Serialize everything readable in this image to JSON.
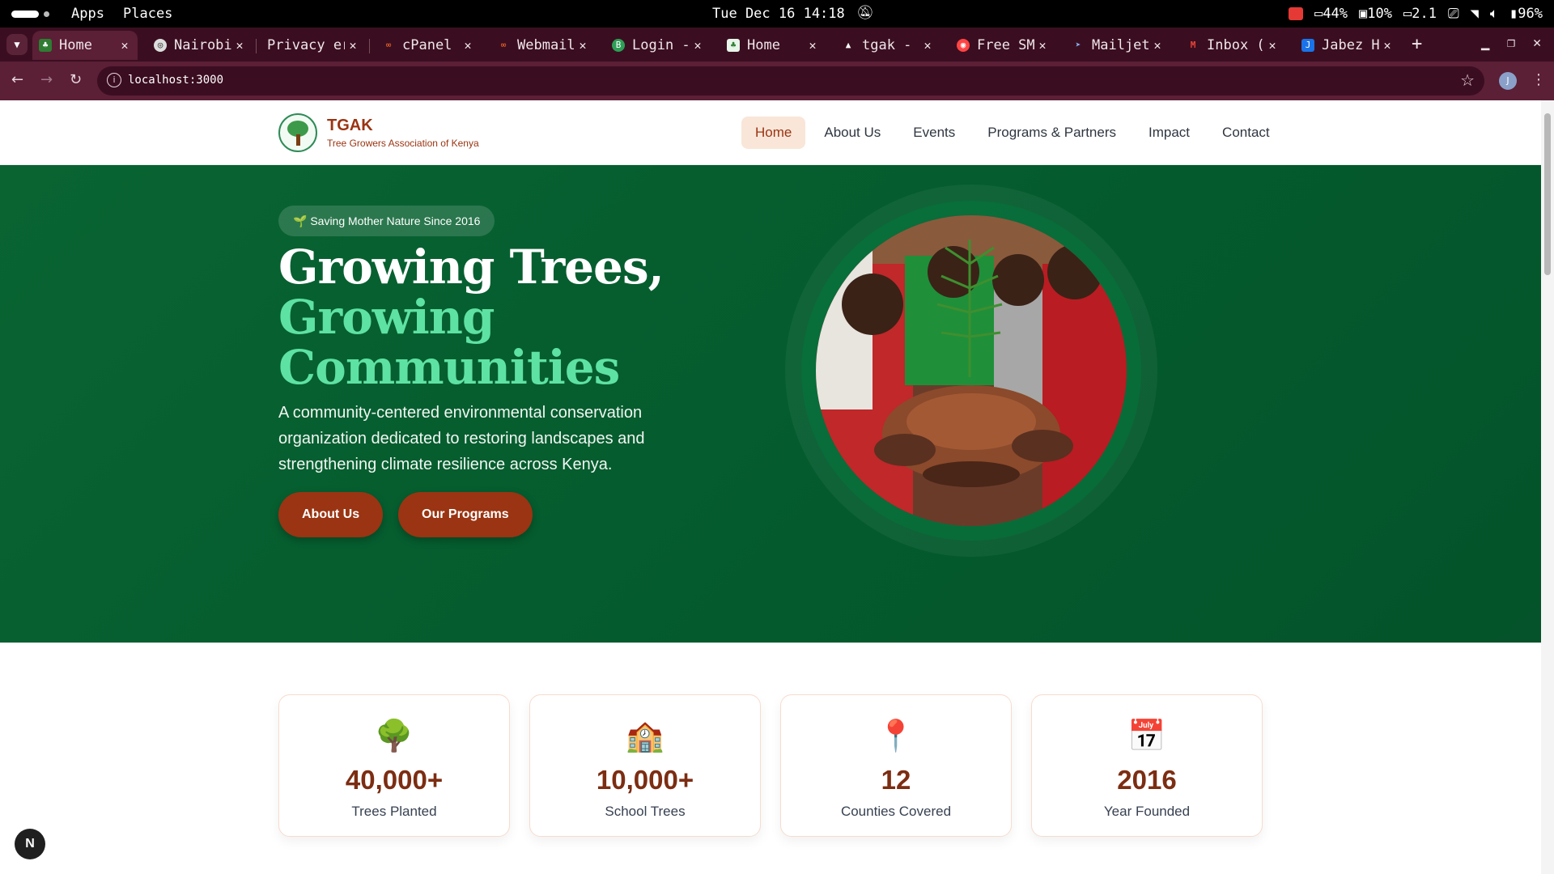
{
  "os": {
    "menu_apps": "Apps",
    "menu_places": "Places",
    "clock": "Tue Dec 16 14:18",
    "tray": {
      "cpu": "44%",
      "mem": "10%",
      "load": "2.1",
      "battery": "96%"
    }
  },
  "browser": {
    "tabs": [
      {
        "title": "Home",
        "active": true
      },
      {
        "title": "Nairobi"
      },
      {
        "title": "Privacy er"
      },
      {
        "title": "cPanel"
      },
      {
        "title": "Webmail"
      },
      {
        "title": "Login -"
      },
      {
        "title": "Home"
      },
      {
        "title": "tgak -"
      },
      {
        "title": "Free SM"
      },
      {
        "title": "Mailjet"
      },
      {
        "title": "Inbox ("
      },
      {
        "title": "Jabez H"
      }
    ],
    "url": "localhost:3000",
    "profile_initial": "J"
  },
  "site": {
    "brand": {
      "name": "TGAK",
      "subtitle": "Tree Growers Association of Kenya"
    },
    "nav": [
      "Home",
      "About Us",
      "Events",
      "Programs & Partners",
      "Impact",
      "Contact"
    ],
    "nav_active_index": 0,
    "hero": {
      "badge": "🌱 Saving Mother Nature Since 2016",
      "title_line1": "Growing Trees,",
      "title_line2": "Growing",
      "title_line3": "Communities",
      "description": "A community-centered environmental conservation organization dedicated to restoring landscapes and strengthening climate resilience across Kenya.",
      "buttons": [
        "About Us",
        "Our Programs"
      ]
    },
    "stats": [
      {
        "icon": "tree-icon",
        "value": "40,000+",
        "label": "Trees Planted"
      },
      {
        "icon": "school-icon",
        "value": "10,000+",
        "label": "School Trees"
      },
      {
        "icon": "pin-icon",
        "value": "12",
        "label": "Counties Covered"
      },
      {
        "icon": "calendar-icon",
        "value": "2016",
        "label": "Year Founded"
      }
    ],
    "next_badge": "N"
  },
  "colors": {
    "brand_green": "#096432",
    "brand_rust": "#9a3412",
    "accent_mint": "#5ee2a4",
    "tab_bar": "#3a0e20"
  }
}
